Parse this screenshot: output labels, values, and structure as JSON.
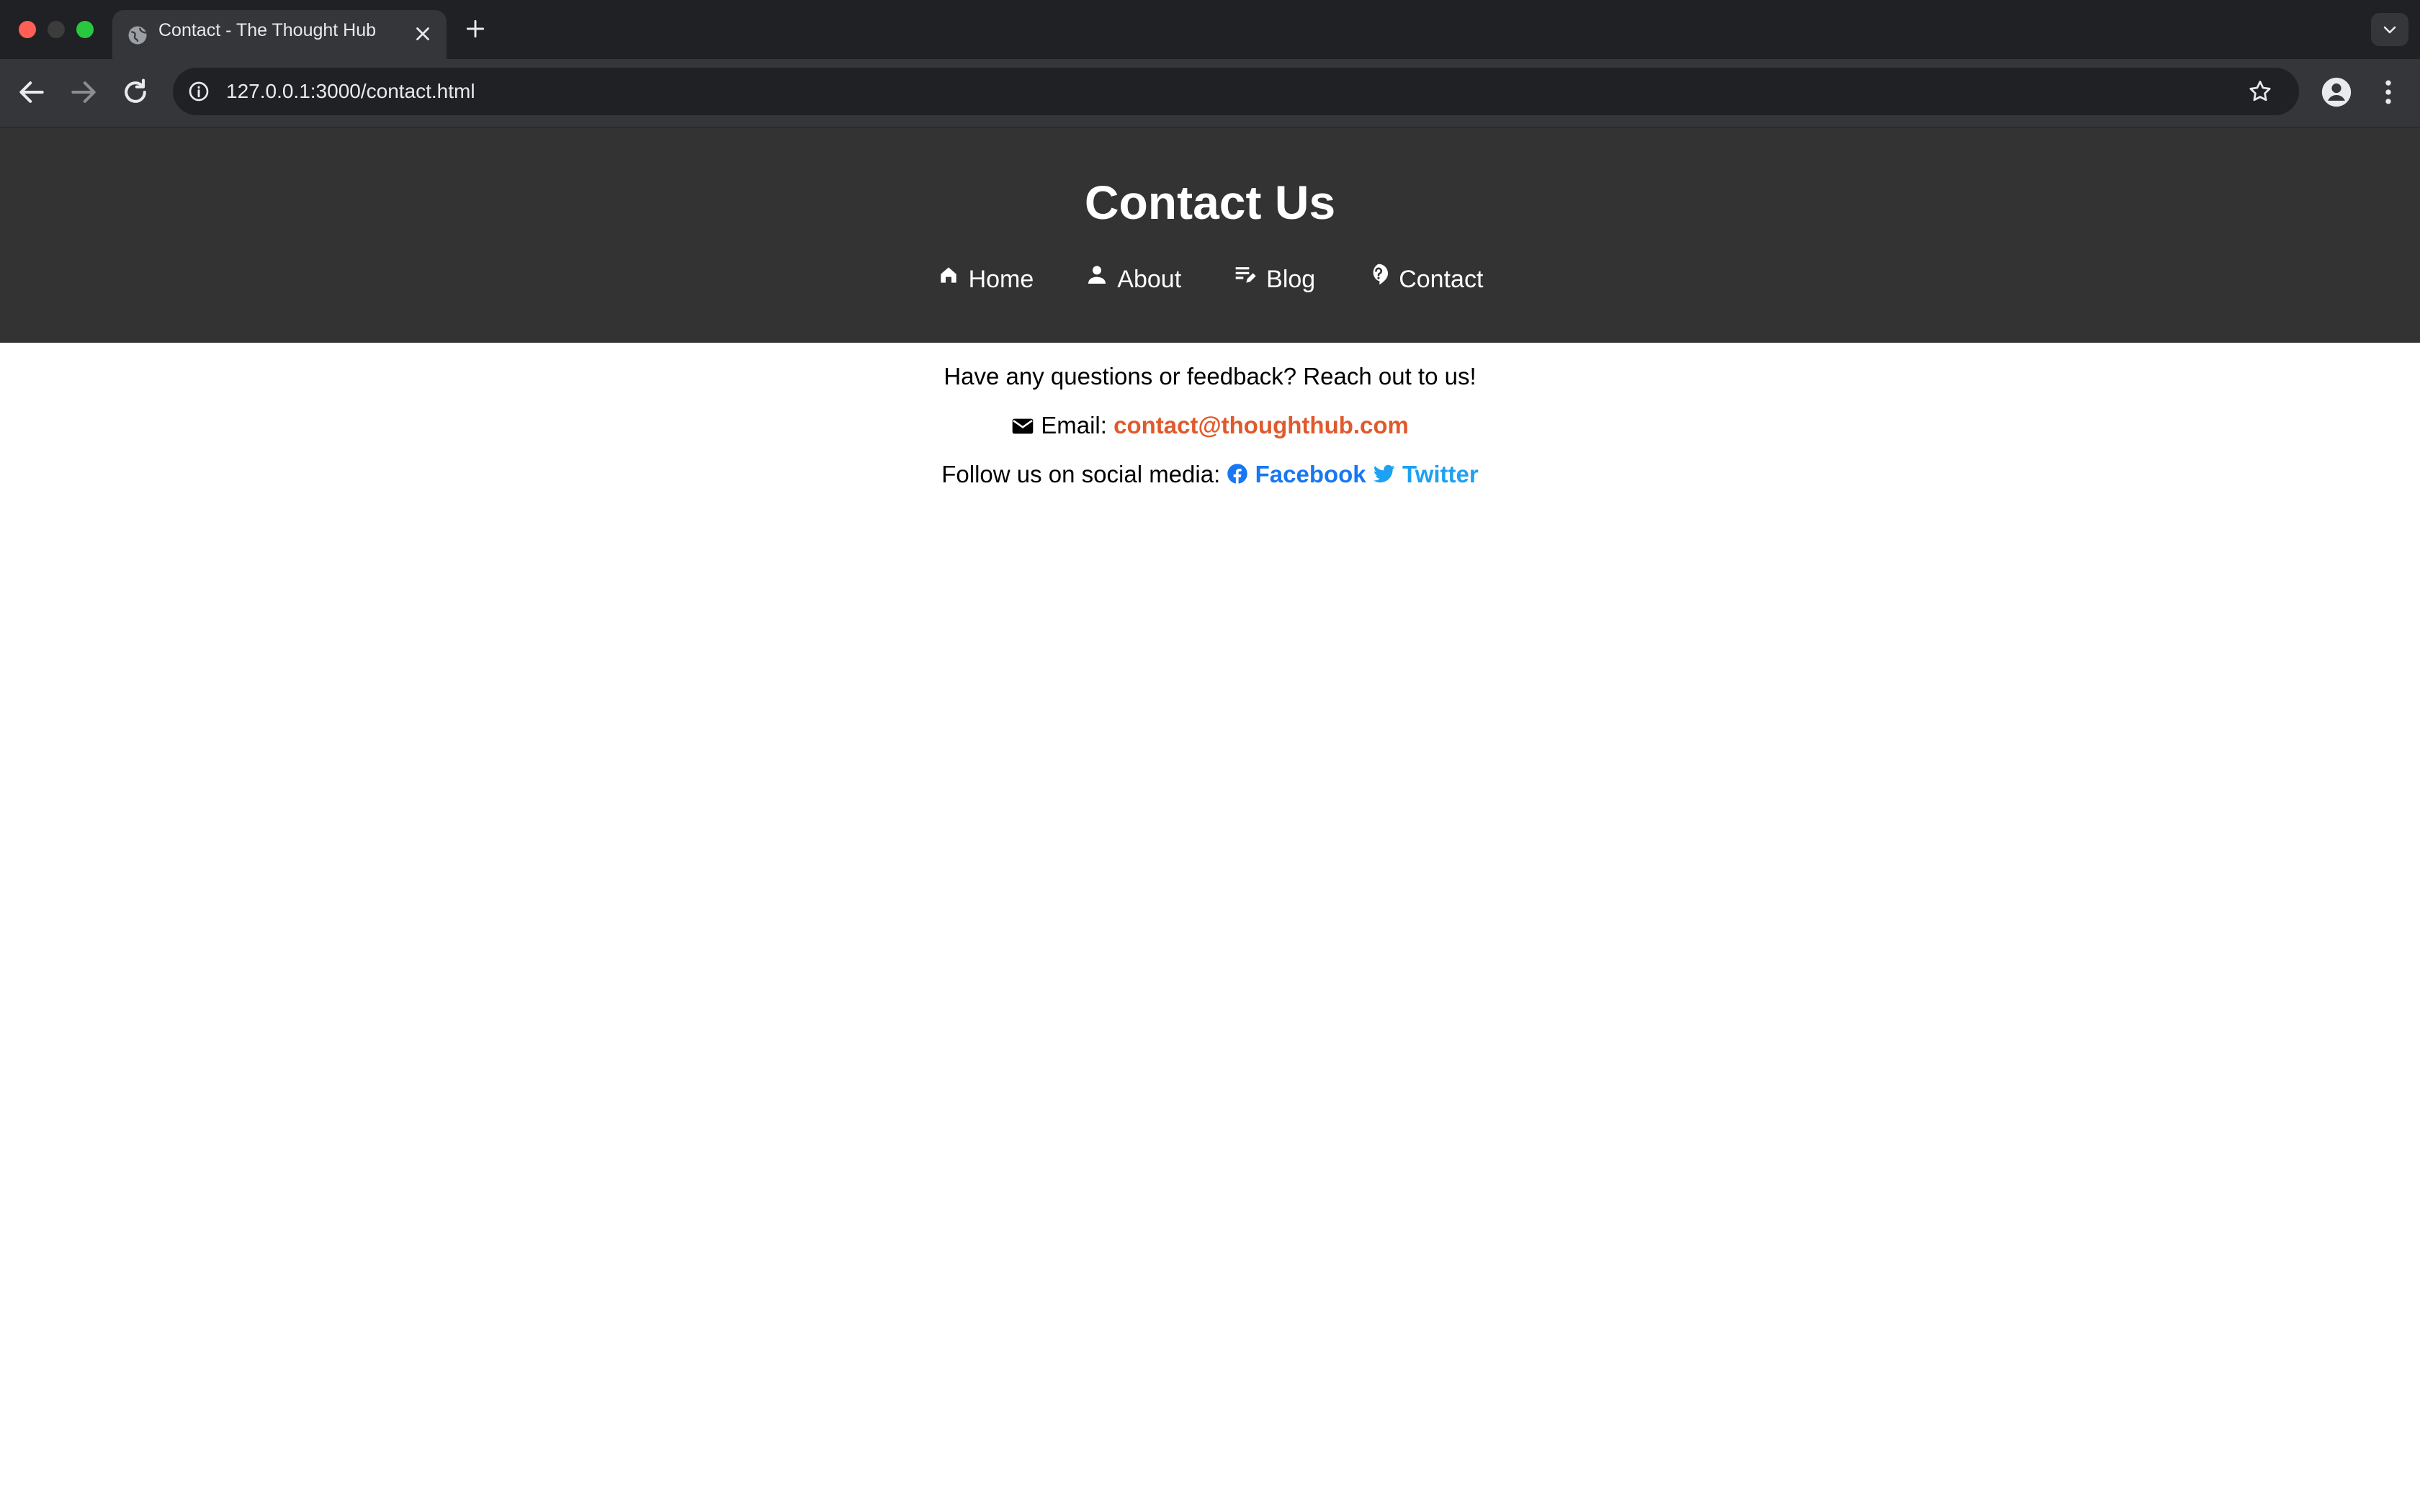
{
  "browser": {
    "tab_title": "Contact - The Thought Hub",
    "url": "127.0.0.1:3000/contact.html"
  },
  "header": {
    "title": "Contact Us",
    "nav": [
      {
        "label": "Home",
        "icon": "home-icon"
      },
      {
        "label": "About",
        "icon": "person-icon"
      },
      {
        "label": "Blog",
        "icon": "edit-note-icon"
      },
      {
        "label": "Contact",
        "icon": "contact-support-icon"
      }
    ]
  },
  "contact": {
    "intro": "Have any questions or feedback? Reach out to us!",
    "email_label": "Email:",
    "email": "contact@thoughthub.com",
    "social_label": "Follow us on social media:",
    "facebook": "Facebook",
    "twitter": "Twitter"
  },
  "colors": {
    "header_bg": "#333333",
    "email_link": "#e05a2b",
    "facebook": "#1877f2",
    "twitter": "#1da1f2"
  }
}
